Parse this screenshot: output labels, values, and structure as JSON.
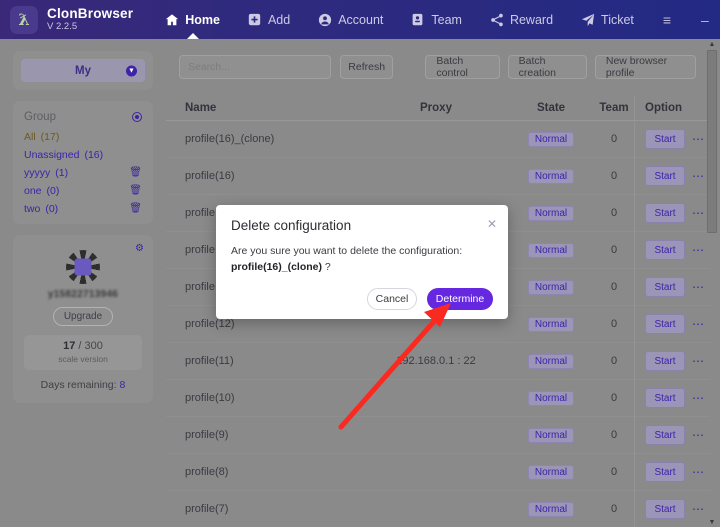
{
  "titlebar": {
    "brand_name": "ClonBrowser",
    "version": "V 2.2.5",
    "logo_icon": "clonbrowser-logo-icon",
    "nav": [
      {
        "label": "Home",
        "icon": "home-icon",
        "active": true
      },
      {
        "label": "Add",
        "icon": "plus-square-icon",
        "active": false
      },
      {
        "label": "Account",
        "icon": "user-circle-icon",
        "active": false
      },
      {
        "label": "Team",
        "icon": "id-card-icon",
        "active": false
      },
      {
        "label": "Reward",
        "icon": "share-icon",
        "active": false
      },
      {
        "label": "Ticket",
        "icon": "paper-plane-icon",
        "active": false
      }
    ],
    "window_controls": [
      {
        "name": "menu-button",
        "glyph": "≡"
      },
      {
        "name": "minimize-button",
        "glyph": "–"
      },
      {
        "name": "maximize-button",
        "glyph": "□"
      },
      {
        "name": "close-button",
        "glyph": "✕"
      }
    ]
  },
  "sidebar": {
    "my_button_label": "My",
    "my_chevron_icon": "chevron-down-icon",
    "group": {
      "title": "Group",
      "add_icon": "add-group-icon",
      "items": [
        {
          "label": "All",
          "count": "(17)",
          "deletable": false,
          "highlight": true
        },
        {
          "label": "Unassigned",
          "count": "(16)",
          "deletable": false,
          "highlight": false
        },
        {
          "label": "yyyyy",
          "count": "(1)",
          "deletable": true,
          "highlight": false
        },
        {
          "label": "one",
          "count": "(0)",
          "deletable": true,
          "highlight": false
        },
        {
          "label": "two",
          "count": "(0)",
          "deletable": true,
          "highlight": false
        }
      ],
      "trash_icon": "trash-icon"
    },
    "account": {
      "gear_icon": "gear-icon",
      "avatar_icon": "avatar",
      "username": "y15822713946",
      "upgrade_label": "Upgrade",
      "quota_used": "17",
      "quota_total": "/ 300",
      "quota_sub": "scale version",
      "days_label": "Days remaining:",
      "days_value": "8"
    }
  },
  "main": {
    "toolbar": {
      "search_placeholder": "Search...",
      "search_value": "",
      "refresh_label": "Refresh",
      "batch_control_label": "Batch control",
      "batch_creation_label": "Batch creation",
      "new_profile_label": "New browser profile"
    },
    "table": {
      "columns": [
        "Name",
        "Proxy",
        "State",
        "Team",
        "Option"
      ],
      "start_label": "Start",
      "more_icon": "more-options-icon",
      "rows": [
        {
          "name": "profile(16)_(clone)",
          "proxy": "",
          "state": "Normal",
          "team": "0"
        },
        {
          "name": "profile(16)",
          "proxy": "",
          "state": "Normal",
          "team": "0"
        },
        {
          "name": "profile",
          "proxy": "",
          "state": "Normal",
          "team": "0"
        },
        {
          "name": "profile",
          "proxy": "",
          "state": "Normal",
          "team": "0"
        },
        {
          "name": "profile",
          "proxy": "",
          "state": "Normal",
          "team": "0"
        },
        {
          "name": "profile(12)",
          "proxy": "",
          "state": "Normal",
          "team": "0"
        },
        {
          "name": "profile(11)",
          "proxy": "192.168.0.1 : 22",
          "state": "Normal",
          "team": "0"
        },
        {
          "name": "profile(10)",
          "proxy": "",
          "state": "Normal",
          "team": "0"
        },
        {
          "name": "profile(9)",
          "proxy": "",
          "state": "Normal",
          "team": "0"
        },
        {
          "name": "profile(8)",
          "proxy": "",
          "state": "Normal",
          "team": "0"
        },
        {
          "name": "profile(7)",
          "proxy": "",
          "state": "Normal",
          "team": "0"
        }
      ]
    }
  },
  "modal": {
    "title": "Delete configuration",
    "close_icon": "close-icon",
    "message": "Are you sure you want to delete the configuration:",
    "target_name": "profile(16)_(clone)",
    "target_suffix": " ?",
    "cancel_label": "Cancel",
    "determine_label": "Determine"
  },
  "annotation": {
    "arrow_icon": "red-pointer-arrow",
    "color": "#fb2a21"
  },
  "colors": {
    "titlebar_start": "#3a2878",
    "titlebar_end": "#232a83",
    "accent": "#3d23a8",
    "primary_button": "#6528e0",
    "page_background": "#8a8a8a"
  }
}
